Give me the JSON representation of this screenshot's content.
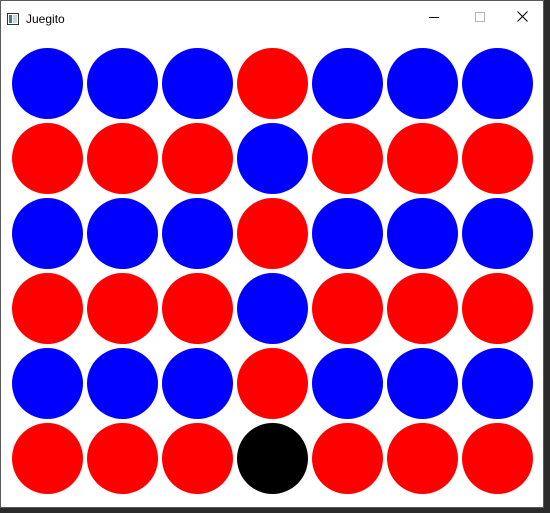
{
  "window": {
    "title": "Juegito",
    "controls": {
      "minimize_icon": "minimize-icon",
      "maximize_icon": "maximize-icon",
      "close_icon": "close-icon"
    }
  },
  "colors": {
    "red": "#ff0000",
    "blue": "#0000ff",
    "black": "#000000"
  },
  "board": {
    "rows": 6,
    "columns": 7,
    "cells": [
      [
        "blue",
        "blue",
        "blue",
        "red",
        "blue",
        "blue",
        "blue"
      ],
      [
        "red",
        "red",
        "red",
        "blue",
        "red",
        "red",
        "red"
      ],
      [
        "blue",
        "blue",
        "blue",
        "red",
        "blue",
        "blue",
        "blue"
      ],
      [
        "red",
        "red",
        "red",
        "blue",
        "red",
        "red",
        "red"
      ],
      [
        "blue",
        "blue",
        "blue",
        "red",
        "blue",
        "blue",
        "blue"
      ],
      [
        "red",
        "red",
        "red",
        "black",
        "red",
        "red",
        "red"
      ]
    ]
  }
}
